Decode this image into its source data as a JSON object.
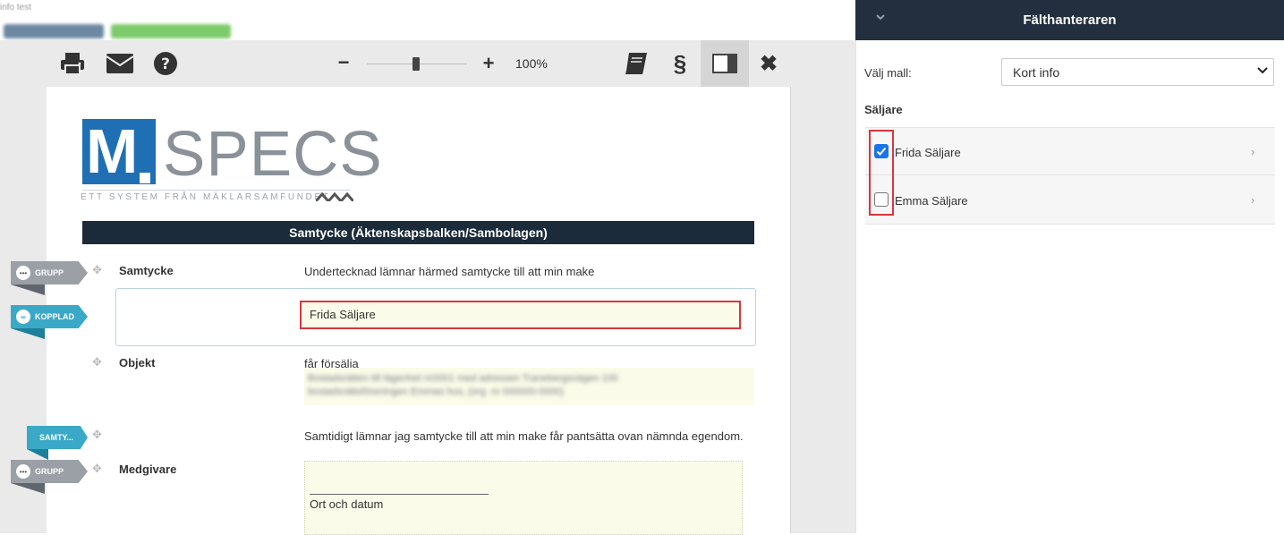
{
  "header_fragments": {
    "title": "info test"
  },
  "toolbar": {
    "print_icon": "print-icon",
    "mail_icon": "mail-icon",
    "help_icon": "help-icon",
    "zoom_minus": "−",
    "zoom_plus": "+",
    "zoom_value": "100%",
    "zoom_level_percent": 100,
    "book_icon": "book-icon",
    "section_symbol": "§",
    "panel_icon": "panel-icon",
    "close_symbol": "✖"
  },
  "logo": {
    "letter": "M",
    "brand": "SPECS",
    "tagline": "ETT SYSTEM FRÅN MÄKLARSAMFUNDET"
  },
  "document": {
    "title": "Samtycke (Äktenskapsbalken/Sambolagen)",
    "rows": {
      "samtycke_label": "Samtycke",
      "samtycke_text": "Undertecknad lämnar härmed samtycke till att min make",
      "linked_value": "Frida Säljare",
      "objekt_label": "Objekt",
      "objekt_text": "får försälja",
      "objekt_blur_line1": "Bostadsrätten till lägenhet nr0001 med adressen Tranebergsvägen 100",
      "objekt_blur_line2": "bostadsrättsföreningen Emmas hus, (org. nr 000000-0000)",
      "pant_text": "Samtidigt lämnar jag samtycke till att min make får pantsätta ovan nämnda egendom.",
      "medgivare_label": "Medgivare",
      "ort_label": "Ort och datum"
    }
  },
  "tags": {
    "grupp1": "GRUPP",
    "kopplad": "KOPPLAD",
    "samty": "SAMTY...",
    "grupp2": "GRUPP"
  },
  "panel": {
    "title": "Fälthanteraren",
    "template_label": "Välj mall:",
    "template_value": "Kort info",
    "section": "Säljare",
    "sellers": [
      {
        "name": "Frida Säljare",
        "checked": true
      },
      {
        "name": "Emma Säljare",
        "checked": false
      }
    ]
  },
  "colors": {
    "panel_header": "#232f3e",
    "doc_header": "#1c2b3a",
    "logo_blue": "#1f6fb4",
    "highlight_red": "#d7373f",
    "tag_grey": "#9aa0a6",
    "tag_blue": "#3aa9c8",
    "field_fill": "#fbfbe9"
  }
}
